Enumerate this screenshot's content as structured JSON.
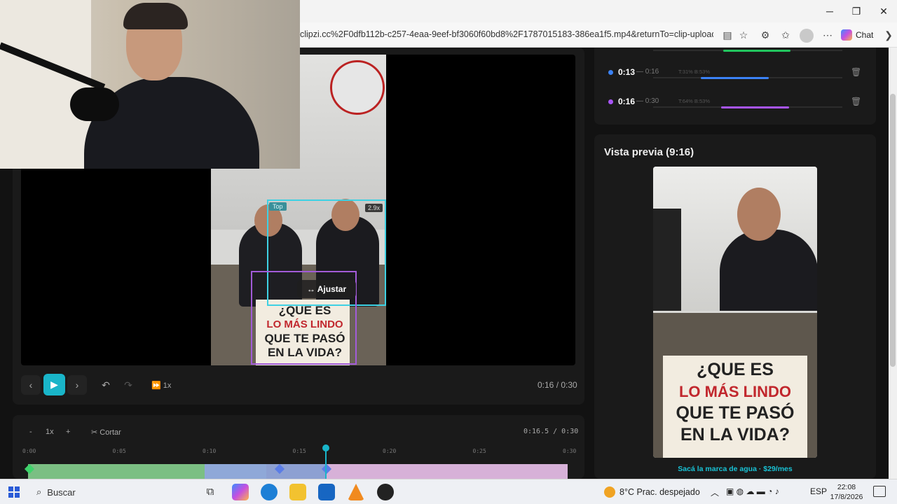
{
  "browser": {
    "url": "clipzi.cc%2F0dfb112b-c257-4eaa-9eef-bf3060f60bd8%2F1787015183-386ea1f5.mp4&returnTo=clip-upload-1786...",
    "chat_label": "Chat"
  },
  "editor": {
    "crop_top_tag": "Top",
    "crop_zoom_tag": "2.9x",
    "adjust_label": "↔ Ajustar",
    "poster_lines": [
      "¿QUE ES",
      "LO MÁS LINDO",
      "QUE TE PASÓ",
      "EN LA VIDA?"
    ],
    "speed_label": "1x",
    "time_readout": "0:16 / 0:30"
  },
  "timeline": {
    "zoom_out": "-",
    "zoom_level": "1x",
    "zoom_in": "+",
    "cut_label": "Cortar",
    "time_readout": "0:16.5 / 0:30",
    "ruler": [
      "0:00",
      "0:05",
      "0:10",
      "0:15",
      "0:20",
      "0:25",
      "0:30"
    ]
  },
  "segments": [
    {
      "start": "0:13",
      "end": "— 0:16",
      "meta": "T:31% B:53%",
      "color": "#3b82f6",
      "fill_start": 0.25,
      "fill_len": 0.36
    },
    {
      "start": "0:16",
      "end": "— 0:30",
      "meta": "T:64% B:53%",
      "color": "#a855f7",
      "fill_start": 0.36,
      "fill_len": 0.36
    }
  ],
  "preview": {
    "title": "Vista previa (9:16)",
    "poster_lines": [
      "¿QUE ES",
      "LO MÁS LINDO",
      "QUE TE PASÓ",
      "EN LA VIDA?"
    ],
    "watermark_cta": "Sacá la marca de agua · $29/mes"
  },
  "taskbar": {
    "search_label": "Buscar",
    "weather": "8°C  Prac. despejado",
    "language": "ESP",
    "time": "22:08",
    "date": "17/8/2026"
  }
}
